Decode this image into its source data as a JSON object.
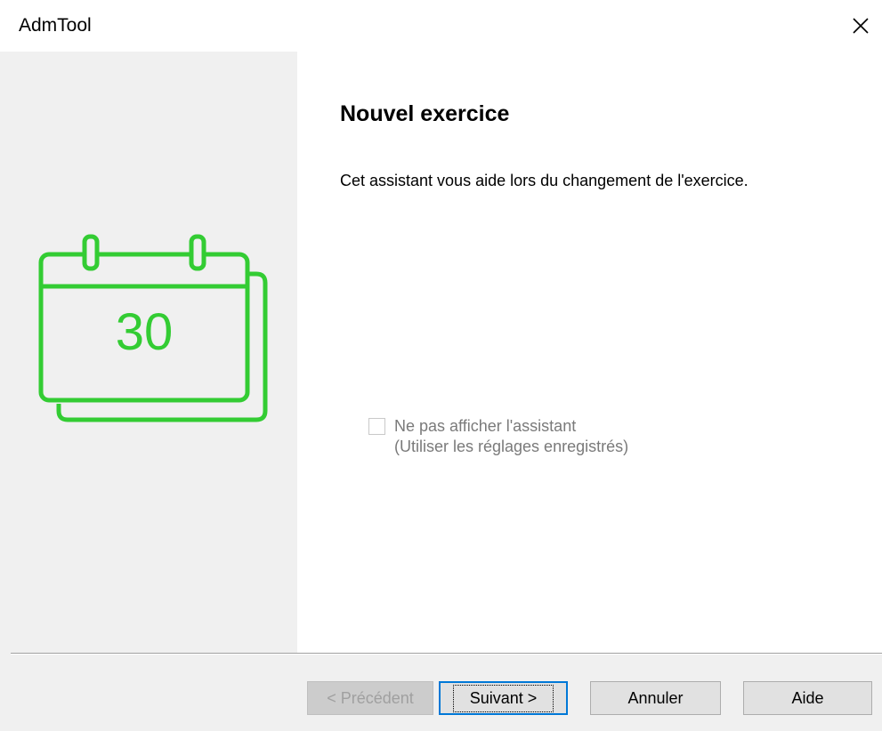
{
  "window": {
    "title": "AdmTool",
    "close_glyph": "✕"
  },
  "wizard": {
    "calendar_day": "30",
    "heading": "Nouvel exercice",
    "description": "Cet assistant vous aide lors du changement de l'exercice.",
    "checkbox": {
      "line1": "Ne pas afficher l'assistant",
      "line2": "(Utiliser les réglages enregistrés)",
      "checked": false,
      "enabled": false
    }
  },
  "buttons": {
    "previous": "< Précédent",
    "next": "Suivant >",
    "cancel": "Annuler",
    "help": "Aide"
  },
  "colors": {
    "calendar": "#33cc33",
    "focus": "#0078d7"
  }
}
